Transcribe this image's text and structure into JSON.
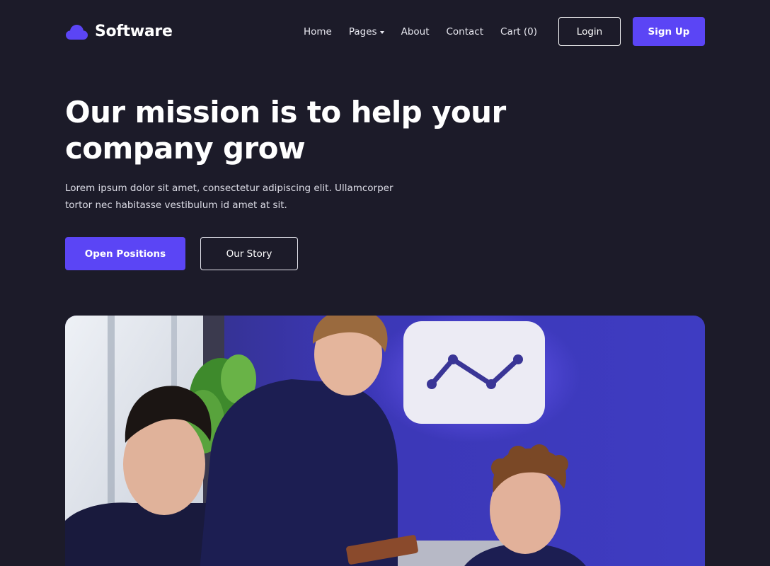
{
  "nav": {
    "brand": "Software",
    "links": [
      "Home",
      "Pages",
      "About",
      "Contact",
      "Cart (0)"
    ],
    "login_label": "Login",
    "signup_label": "Sign Up"
  },
  "hero": {
    "title_line1": "Our mission is to help your",
    "title_line2": "company grow",
    "description_line1": "Lorem ipsum dolor sit amet, consectetur adipiscing elit. Ullamcorper",
    "description_line2": "tortor nec habitasse vestibulum id amet at sit.",
    "primary_cta": "Open Positions",
    "secondary_cta": "Our Story"
  },
  "icons": {
    "logo": "cloud-icon",
    "pages_dropdown": "caret-down-icon"
  },
  "colors": {
    "background": "#1c1b29",
    "accent": "#5b45f5",
    "text": "#ffffff"
  }
}
